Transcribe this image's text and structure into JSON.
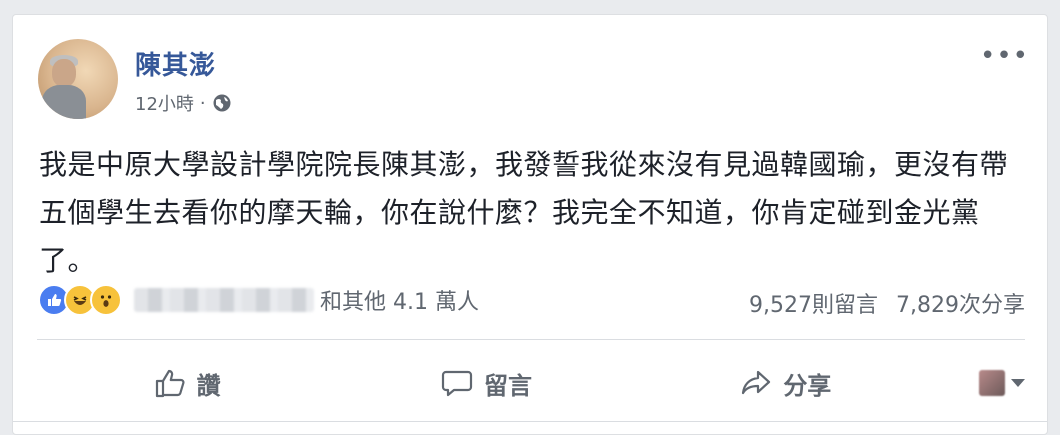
{
  "post": {
    "author": "陳其澎",
    "timestamp": "12小時",
    "separator": "·",
    "privacy_icon": "globe-icon",
    "more_label": "•••",
    "text": "我是中原大學設計學院院長陳其澎，我發誓我從來沒有見過韓國瑜，更沒有帶五個學生去看你的摩天輪，你在說什麼？我完全不知道，你肯定碰到金光黨了。"
  },
  "reactions": {
    "types": [
      "like-icon",
      "haha-icon",
      "wow-icon"
    ],
    "summary": "和其他 4.1 萬人"
  },
  "stats": {
    "comments": "9,527則留言",
    "shares": "7,829次分享"
  },
  "actions": {
    "like": "讚",
    "comment": "留言",
    "share": "分享"
  },
  "colors": {
    "author": "#365899",
    "text": "#1d2129",
    "secondary": "#606770",
    "like_blue": "#4a7df0",
    "emoji_yellow": "#f7c23b"
  }
}
